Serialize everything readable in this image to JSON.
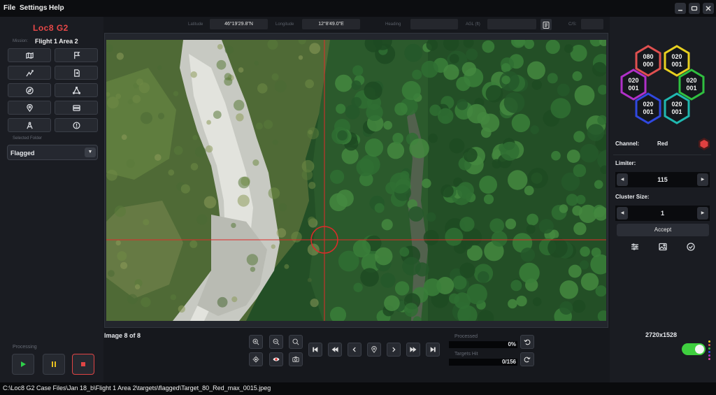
{
  "menu": {
    "file": "File",
    "settings": "Settings",
    "help": "Help"
  },
  "window_controls": [
    "minimize",
    "maximize",
    "close"
  ],
  "app": {
    "name": "Loc8 G2"
  },
  "mission": {
    "label": "Mission:",
    "value": "Flight 1 Area 2"
  },
  "tools": [
    {
      "icon": "map-icon"
    },
    {
      "icon": "flag-icon"
    },
    {
      "icon": "route-icon"
    },
    {
      "icon": "file-export-icon"
    },
    {
      "icon": "compass-icon"
    },
    {
      "icon": "triangle-nodes-icon"
    },
    {
      "icon": "location-pin-icon"
    },
    {
      "icon": "panel-icon"
    },
    {
      "icon": "drafting-compass-icon"
    },
    {
      "icon": "timer-icon"
    }
  ],
  "folder": {
    "label": "Selected Folder",
    "value": "Flagged"
  },
  "processing": {
    "label": "Processing"
  },
  "topinfo": {
    "latitude_label": "Latitude",
    "latitude": "46°19'29.8\"N",
    "longitude_label": "Longitude",
    "longitude": "12°8'49.0\"E",
    "heading_label": "Heading",
    "heading": "",
    "agl_label": "AGL (ft)",
    "agl": "",
    "cs_label": "C/S:",
    "cs": ""
  },
  "image_counter": "Image 8 of 8",
  "progress": {
    "processed_label": "Processed",
    "processed_value": "0%",
    "processed_fraction": 0,
    "targets_label": "Targets Hit",
    "targets_value": "0/156",
    "targets_fraction": 0
  },
  "resolution": "2720x1528",
  "hexes": [
    {
      "top": "080",
      "bottom": "000",
      "color": "#e05050"
    },
    {
      "top": "020",
      "bottom": "001",
      "color": "#e8d020"
    },
    {
      "top": "020",
      "bottom": "001",
      "color": "#b030c8"
    },
    {
      "top": "020",
      "bottom": "001",
      "color": "#30c040"
    },
    {
      "top": "020",
      "bottom": "001",
      "color": "#3048e0"
    },
    {
      "top": "020",
      "bottom": "001",
      "color": "#20b8b0"
    }
  ],
  "channel": {
    "label": "Channel:",
    "value": "Red",
    "color": "#e04040"
  },
  "limiter": {
    "label": "Limiter:",
    "value": "115"
  },
  "cluster": {
    "label": "Cluster Size:",
    "value": "1"
  },
  "accept_label": "Accept",
  "toggle": {
    "on": true,
    "color": "#3fcf3f"
  },
  "indicator_colors": [
    "#e8d020",
    "#e05050",
    "#30c040",
    "#3048e0",
    "#b030c8",
    "#e040a0"
  ],
  "status_path": "C:\\Loc8 G2 Case Files\\Jan 18_b\\Flight 1 Area 2\\targets\\flagged\\Target_80_Red_max_0015.jpeg"
}
